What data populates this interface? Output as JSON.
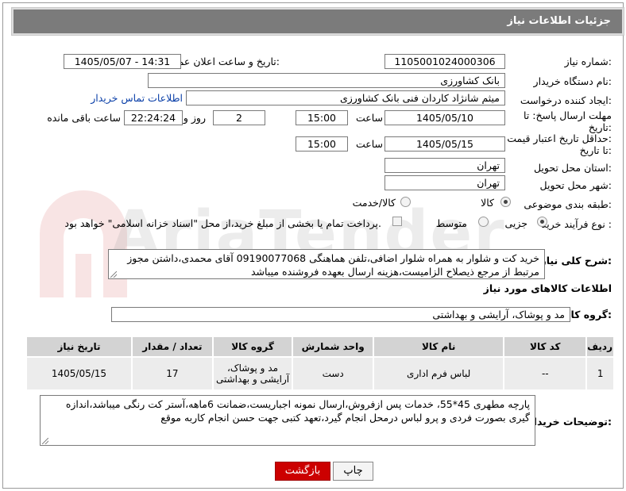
{
  "header": {
    "title": "جزئیات اطلاعات نیاز"
  },
  "labels": {
    "need_number": "شماره نیاز:",
    "announce_datetime": "تاریخ و ساعت اعلان عمومی:",
    "buyer_org": "نام دستگاه خریدار:",
    "requester": "ایجاد کننده درخواست:",
    "deadline_line1": "مهلت ارسال پاسخ: تا",
    "deadline_line2": "تاریخ:",
    "hour": "ساعت",
    "day_and": "روز و",
    "hours_left": "ساعت باقی مانده",
    "price_validity_line1": "حداقل تاریخ اعتبار قیمت:",
    "price_validity_line2": "تا تاریخ:",
    "delivery_province": "استان محل تحویل:",
    "delivery_city": "شهر محل تحویل:",
    "category": "طبقه بندی موضوعی:",
    "purchase_process": "نوع فرآیند خرید :",
    "general_desc": "شرح کلی نیاز:",
    "goods_info": "اطلاعات کالاهای مورد نیاز",
    "goods_group": "گروه کالا:",
    "buyer_notes": "توضیحات خریدار:"
  },
  "values": {
    "need_number": "1105001024000306",
    "announce_datetime": "1405/05/07 - 14:31",
    "buyer_org": "بانک کشاورزی",
    "requester": "میثم شانژاد کاردان فنی بانک کشاورزی",
    "buyer_contact_link": "اطلاعات تماس خریدار",
    "deadline_date": "1405/05/10",
    "deadline_time": "15:00",
    "days_left": "2",
    "time_left": "22:24:24",
    "price_validity_date": "1405/05/15",
    "price_validity_time": "15:00",
    "province": "تهران",
    "city": "تهران",
    "goods_group": "مد و پوشاک، آرایشی و بهداشتی"
  },
  "category_options": [
    {
      "label": "کالا",
      "selected": true
    },
    {
      "label": "کالا/خدمت",
      "selected": false
    }
  ],
  "process_options": [
    {
      "label": "جزیی",
      "selected": true
    },
    {
      "label": "متوسط",
      "selected": false
    }
  ],
  "payment_note": "پرداخت تمام یا بخشی از مبلغ خرید،از محل \"اسناد خزانه اسلامی\" خواهد بود.",
  "general_desc_text": "خرید کت و شلوار به همراه شلوار اضافی،تلفن هماهنگی 09190077068 آقای محمدی،داشتن مجوز مرتبط از مرجع ذیصلاح الزامیست،هزینه ارسال بعهده فروشنده میباشد",
  "table": {
    "headers": [
      "ردیف",
      "کد کالا",
      "نام کالا",
      "واحد شمارش",
      "گروه کالا",
      "تعداد / مقدار",
      "تاریخ نیاز"
    ],
    "rows": [
      [
        "1",
        "--",
        "لباس فرم اداری",
        "دست",
        "مد و پوشاک، آرایشی و بهداشتی",
        "17",
        "1405/05/15"
      ]
    ]
  },
  "buyer_notes_text": "پارچه مطهری 45*55، خدمات پس ازفروش،ارسال نمونه اجباریست،ضمانت 6ماهه،آستر کت رنگی میباشد،اندازه گیری بصورت فردی و پرو لباس درمحل انجام گیرد،تعهد کتبی جهت حسن انجام کاربه موقع",
  "buttons": {
    "back": "بازگشت",
    "print": "چاپ"
  },
  "colors": {
    "header_bg": "#7b7b7b",
    "back_button": "#cc0000",
    "link": "#0a3fa8"
  }
}
